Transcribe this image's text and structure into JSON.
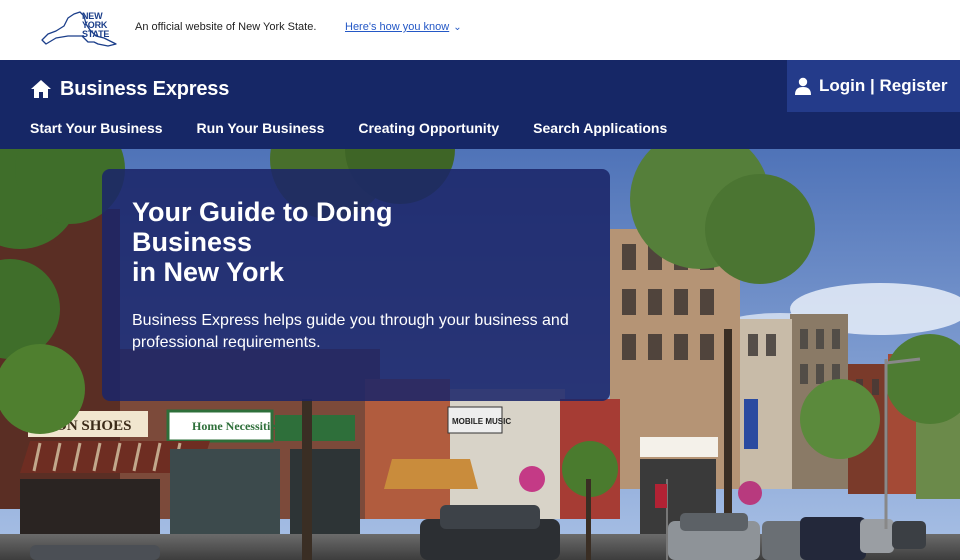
{
  "gov_banner": {
    "logo_text": [
      "NEW",
      "YORK",
      "STATE"
    ],
    "official_text": "An official website of New York State.",
    "how_link": "Here's how you know"
  },
  "header": {
    "brand_name": "Business Express",
    "brand_icon": "home-icon",
    "login_label": "Login | Register",
    "login_icon": "user-icon",
    "nav": [
      "Start Your Business",
      "Run Your Business",
      "Creating Opportunity",
      "Search Applications"
    ],
    "colors": {
      "header_bg": "#162766",
      "login_bg": "#243b8a",
      "link": "#2458c6"
    }
  },
  "hero": {
    "title_lines": [
      "Your Guide to Doing",
      "Business",
      "in New York"
    ],
    "subtitle": "Business Express helps guide you through your business and professional requirements.",
    "signs": [
      "DSON SHOES",
      "Home Necessities",
      "MOBILE MUSIC"
    ]
  }
}
